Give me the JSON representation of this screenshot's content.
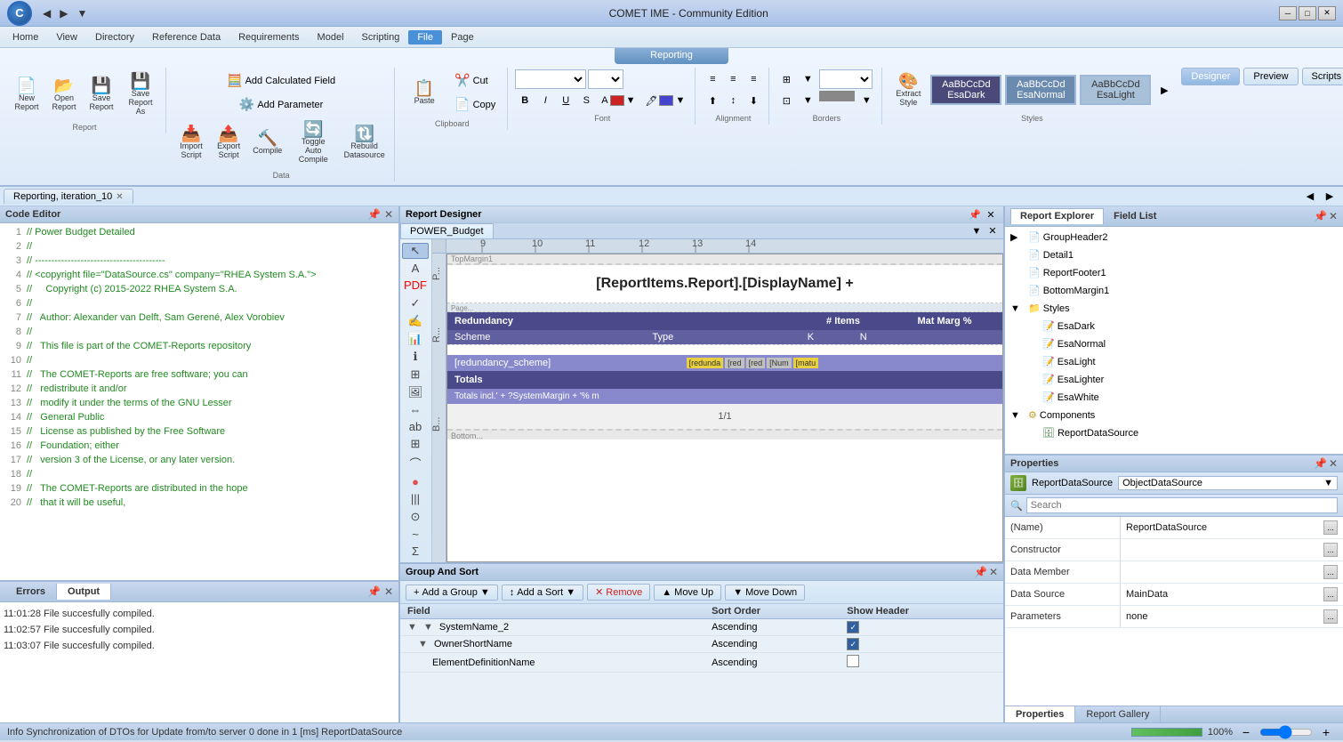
{
  "app": {
    "title": "COMET IME - Community Edition",
    "logo": "C"
  },
  "menu": {
    "items": [
      "Home",
      "View",
      "Directory",
      "Reference Data",
      "Requirements",
      "Model",
      "Scripting",
      "File",
      "Page"
    ]
  },
  "ribbon": {
    "reporting_tab": "Reporting",
    "active_section": "File",
    "report_group": {
      "label": "Report",
      "buttons": [
        {
          "label": "New\nReport",
          "icon": "📄"
        },
        {
          "label": "Open\nReport",
          "icon": "📂"
        },
        {
          "label": "Save\nReport",
          "icon": "💾"
        },
        {
          "label": "Save\nReport As",
          "icon": "💾"
        }
      ]
    },
    "data_group": {
      "label": "Data",
      "buttons": [
        {
          "label": "Add Calculated Field",
          "icon": "🧮"
        },
        {
          "label": "Add Parameter",
          "icon": "⚙️"
        },
        {
          "label": "Import Script",
          "icon": "📥"
        },
        {
          "label": "Export Script",
          "icon": "📤"
        },
        {
          "label": "Compile",
          "icon": "🔨"
        },
        {
          "label": "Toggle Auto Compile",
          "icon": "🔄"
        },
        {
          "label": "Rebuild Datasource",
          "icon": "🔃"
        }
      ]
    },
    "clipboard_group": {
      "label": "Clipboard",
      "paste_label": "Paste",
      "cut_label": "Cut",
      "copy_label": "Copy"
    },
    "font_group": {
      "label": "Font",
      "bold": "B",
      "italic": "I",
      "underline": "U",
      "strikethrough": "S"
    },
    "alignment_group": {
      "label": "Alignment"
    },
    "borders_group": {
      "label": "Borders"
    },
    "styles_group": {
      "label": "Styles",
      "extract_label": "Extract\nStyle",
      "swatches": [
        {
          "name": "EsaDark",
          "class": "esa-dark"
        },
        {
          "name": "EsaNormal",
          "class": "esa-normal"
        },
        {
          "name": "EsaLight",
          "class": "esa-light"
        }
      ]
    },
    "view_tabs": [
      "Designer",
      "Preview",
      "Scripts"
    ]
  },
  "tab_bar": {
    "tabs": [
      {
        "label": "Reporting, iteration_10",
        "closable": true
      }
    ]
  },
  "code_editor": {
    "title": "Code Editor",
    "lines": [
      {
        "num": 1,
        "text": "// Power Budget Detailed"
      },
      {
        "num": 2,
        "text": "//"
      },
      {
        "num": 3,
        "text": "// ----------------------------------------"
      },
      {
        "num": 4,
        "text": "// <copyright file=\"DataSource.cs\" company=\"RHEA System S.A.\">"
      },
      {
        "num": 5,
        "text": "//   Copyright (c) 2015-2022 RHEA System S.A."
      },
      {
        "num": 6,
        "text": "//"
      },
      {
        "num": 7,
        "text": "//   Author: Alexander van Delft, Sam Gerené, Alex Vorobiev"
      },
      {
        "num": 8,
        "text": "//"
      },
      {
        "num": 9,
        "text": "//   This file is part of the COMET-Reports repository"
      },
      {
        "num": 10,
        "text": "//"
      },
      {
        "num": 11,
        "text": "//   The COMET-Reports are free software; you can"
      },
      {
        "num": 12,
        "text": "//   redistribute it and/or"
      },
      {
        "num": 13,
        "text": "//   modify it under the terms of the GNU Lesser"
      },
      {
        "num": 14,
        "text": "//   General Public"
      },
      {
        "num": 15,
        "text": "//   License as published by the Free Software"
      },
      {
        "num": 16,
        "text": "//   Foundation; either"
      },
      {
        "num": 17,
        "text": "//   version 3 of the License, or any later version."
      },
      {
        "num": 18,
        "text": "//"
      },
      {
        "num": 19,
        "text": "//   The COMET-Reports are distributed in the hope"
      },
      {
        "num": 20,
        "text": "//   that it will be useful,"
      }
    ]
  },
  "errors_panel": {
    "tabs": [
      "Errors",
      "Output"
    ],
    "active_tab": "Output",
    "messages": [
      "11:01:28 File succesfully compiled.",
      "11:02:57 File succesfully compiled.",
      "11:03:07 File succesfully compiled."
    ]
  },
  "report_designer": {
    "title": "Report Designer",
    "tab_label": "POWER_Budget",
    "report_title": "[ReportItems.Report].[DisplayName] +",
    "table": {
      "main_header": "Redundancy",
      "columns": [
        "Scheme",
        "Type",
        "K",
        "N",
        "# Items",
        "Mat Marg %"
      ],
      "data_row": "[redundancy_scheme]",
      "data_cells": [
        "[redunda",
        "[red",
        "[red",
        "[Num",
        "[matu"
      ],
      "totals_label": "Totals",
      "totals_row": "Totals incl.' + ?SystemMargin + '% m",
      "page_num": "1/1"
    }
  },
  "group_sort": {
    "title": "Group And Sort",
    "toolbar": {
      "add_group": "Add a Group",
      "add_sort": "Add a Sort",
      "remove": "Remove",
      "move_up": "Move Up",
      "move_down": "Move Down"
    },
    "columns": [
      "Field",
      "Sort Order",
      "Show Header"
    ],
    "rows": [
      {
        "indent": 0,
        "expand": true,
        "field": "SystemName_2",
        "sort_order": "Ascending",
        "show_header": true
      },
      {
        "indent": 1,
        "expand": true,
        "field": "OwnerShortName",
        "sort_order": "Ascending",
        "show_header": true
      },
      {
        "indent": 2,
        "expand": false,
        "field": "ElementDefinitionName",
        "sort_order": "Ascending",
        "show_header": false
      }
    ]
  },
  "report_explorer": {
    "title": "Report Explorer",
    "tabs": [
      "Report Explorer",
      "Field List"
    ],
    "active_tab": "Report Explorer",
    "tree": [
      {
        "level": 1,
        "expand": true,
        "icon": "page",
        "label": "GroupHeader2"
      },
      {
        "level": 1,
        "expand": false,
        "icon": "page",
        "label": "Detail1"
      },
      {
        "level": 1,
        "expand": false,
        "icon": "page",
        "label": "ReportFooter1"
      },
      {
        "level": 1,
        "expand": false,
        "icon": "page",
        "label": "BottomMargin1"
      },
      {
        "level": 0,
        "expand": true,
        "icon": "folder",
        "label": "Styles"
      },
      {
        "level": 1,
        "expand": false,
        "icon": "style",
        "label": "EsaDark"
      },
      {
        "level": 1,
        "expand": false,
        "icon": "style",
        "label": "EsaNormal"
      },
      {
        "level": 1,
        "expand": false,
        "icon": "style",
        "label": "EsaLight"
      },
      {
        "level": 1,
        "expand": false,
        "icon": "style",
        "label": "EsaLighter"
      },
      {
        "level": 1,
        "expand": false,
        "icon": "style",
        "label": "EsaWhite"
      },
      {
        "level": 0,
        "expand": true,
        "icon": "folder",
        "label": "Components"
      },
      {
        "level": 1,
        "expand": false,
        "icon": "component",
        "label": "ReportDataSource"
      }
    ]
  },
  "properties": {
    "title": "Properties",
    "source_name": "ReportDataSource",
    "source_type": "ObjectDataSource",
    "search_placeholder": "Search",
    "rows": [
      {
        "name": "(Name)",
        "value": "ReportDataSource"
      },
      {
        "name": "Constructor",
        "value": ""
      },
      {
        "name": "Data Member",
        "value": ""
      },
      {
        "name": "Data Source",
        "value": "MainData"
      },
      {
        "name": "Parameters",
        "value": "none"
      }
    ],
    "footer_tabs": [
      "Properties",
      "Report Gallery"
    ]
  },
  "status_bar": {
    "message": "Info  Synchronization of DTOs for Update from/to server 0 done in 1 [ms]  ReportDataSource",
    "zoom": "100%",
    "progress": 100
  }
}
